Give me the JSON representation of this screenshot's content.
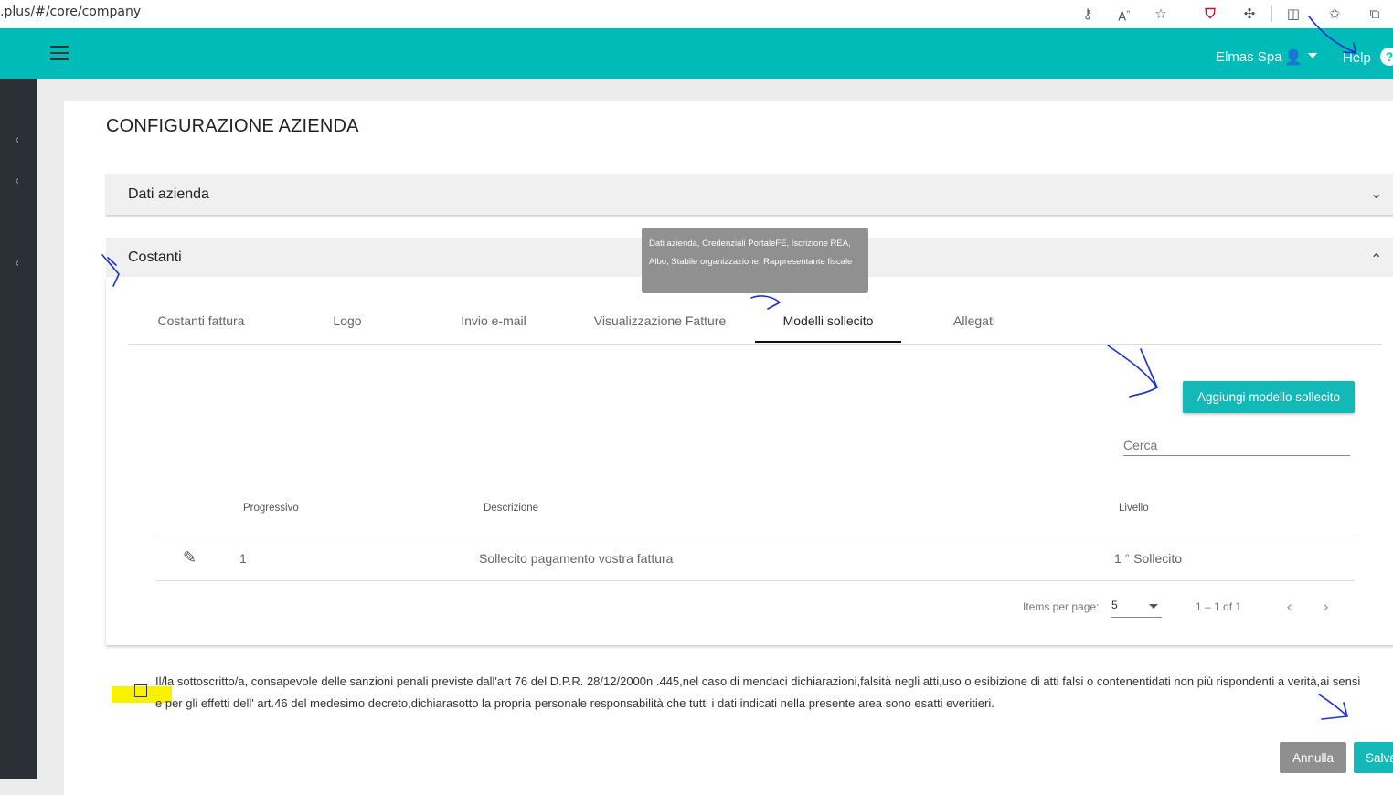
{
  "browser": {
    "url": ".plus/#/core/company",
    "icons": [
      "key-icon",
      "read-aloud-icon",
      "favorite-star-icon",
      "mcafee-icon",
      "extensions-icon",
      "split-screen-icon",
      "favorites-icon",
      "collections-icon"
    ]
  },
  "header": {
    "user": "Elmas Spa",
    "help": "Help",
    "help_icon": "?"
  },
  "page": {
    "title": "CONFIGURAZIONE AZIENDA"
  },
  "panels": {
    "dati": {
      "title": "Dati azienda",
      "chevron": "⌄"
    },
    "costanti": {
      "title": "Costanti",
      "chevron": "⌃"
    }
  },
  "tooltip": {
    "text": "Dati azienda, Credenziali PortaleFE, Iscrizione REA, Albo, Stabile organizzazione, Rappresentante fiscale"
  },
  "tabs": [
    {
      "label": "Costanti fattura"
    },
    {
      "label": "Logo"
    },
    {
      "label": "Invio e-mail"
    },
    {
      "label": "Visualizzazione Fatture"
    },
    {
      "label": "Modelli sollecito",
      "active": true
    },
    {
      "label": "Allegati"
    }
  ],
  "actions": {
    "add_model": "Aggiungi modello sollecito",
    "search_placeholder": "Cerca"
  },
  "table": {
    "headers": [
      "Progressivo",
      "Descrizione",
      "Livello"
    ],
    "rows": [
      {
        "progressivo": "1",
        "descrizione": "Sollecito pagamento vostra fattura",
        "livello": "1 ° Sollecito"
      }
    ]
  },
  "paginator": {
    "items_per_page_label": "Items per page:",
    "page_size": "5",
    "range": "1 – 1 of 1",
    "prev": "‹",
    "next": "›"
  },
  "declaration": {
    "text": "Il/la sottoscritto/a, consapevole delle sanzioni penali previste dall'art 76 del D.P.R. 28/12/2000n .445,nel caso di mendaci dichiarazioni,falsità negli atti,uso o esibizione di atti falsi o contenentidati non più rispondenti a verità,ai sensi e per gli effetti dell' art.46 del medesimo decreto,dichiarasotto la propria personale responsabilità che tutti i dati indicati nella presente area sono esatti everitieri.",
    "checked": false
  },
  "footer": {
    "cancel": "Annulla",
    "save": "Salva"
  },
  "colors": {
    "accent": "#00bbb7",
    "sidebar": "#2b2f36",
    "annotation_ink": "#1f2fd0",
    "highlight": "#f8f200"
  }
}
